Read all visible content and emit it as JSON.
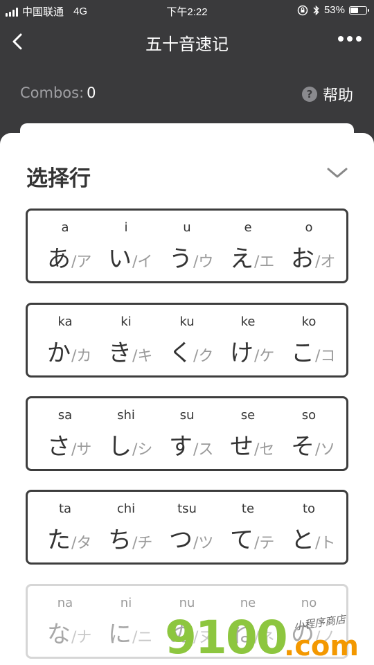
{
  "status": {
    "carrier": "中国联通",
    "network": "4G",
    "time": "下午2:22",
    "battery": "53%",
    "battery_level": 0.53
  },
  "nav": {
    "title": "五十音速记",
    "back_icon": "chevron-left-icon",
    "more_icon": "more-dots-icon"
  },
  "combos": {
    "label": "Combos:",
    "value": "0"
  },
  "help": {
    "label": "帮助",
    "icon": "question-circle-icon"
  },
  "sheet": {
    "title": "选择行",
    "collapse_icon": "chevron-down-icon"
  },
  "rows": [
    {
      "cells": [
        {
          "romaji": "a",
          "hira": "あ",
          "kata": "/ア"
        },
        {
          "romaji": "i",
          "hira": "い",
          "kata": "/イ"
        },
        {
          "romaji": "u",
          "hira": "う",
          "kata": "/ウ"
        },
        {
          "romaji": "e",
          "hira": "え",
          "kata": "/エ"
        },
        {
          "romaji": "o",
          "hira": "お",
          "kata": "/オ"
        }
      ]
    },
    {
      "cells": [
        {
          "romaji": "ka",
          "hira": "か",
          "kata": "/カ"
        },
        {
          "romaji": "ki",
          "hira": "き",
          "kata": "/キ"
        },
        {
          "romaji": "ku",
          "hira": "く",
          "kata": "/ク"
        },
        {
          "romaji": "ke",
          "hira": "け",
          "kata": "/ケ"
        },
        {
          "romaji": "ko",
          "hira": "こ",
          "kata": "/コ"
        }
      ]
    },
    {
      "cells": [
        {
          "romaji": "sa",
          "hira": "さ",
          "kata": "/サ"
        },
        {
          "romaji": "shi",
          "hira": "し",
          "kata": "/シ"
        },
        {
          "romaji": "su",
          "hira": "す",
          "kata": "/ス"
        },
        {
          "romaji": "se",
          "hira": "せ",
          "kata": "/セ"
        },
        {
          "romaji": "so",
          "hira": "そ",
          "kata": "/ソ"
        }
      ]
    },
    {
      "cells": [
        {
          "romaji": "ta",
          "hira": "た",
          "kata": "/タ"
        },
        {
          "romaji": "chi",
          "hira": "ち",
          "kata": "/チ"
        },
        {
          "romaji": "tsu",
          "hira": "つ",
          "kata": "/ツ"
        },
        {
          "romaji": "te",
          "hira": "て",
          "kata": "/テ"
        },
        {
          "romaji": "to",
          "hira": "と",
          "kata": "/ト"
        }
      ]
    },
    {
      "cells": [
        {
          "romaji": "na",
          "hira": "な",
          "kata": "/ナ"
        },
        {
          "romaji": "ni",
          "hira": "に",
          "kata": "/ニ"
        },
        {
          "romaji": "nu",
          "hira": "ぬ",
          "kata": "/ヌ"
        },
        {
          "romaji": "ne",
          "hira": "ね",
          "kata": "/ネ"
        },
        {
          "romaji": "no",
          "hira": "の",
          "kata": "/ノ"
        }
      ]
    }
  ],
  "watermark": {
    "main": "9100",
    "domain": ".com",
    "sub": "小程序商店"
  },
  "colors": {
    "background": "#3a3a3c",
    "card_border": "#3d3d3d",
    "card_border_dim": "#d6d6d6",
    "watermark_green": "#8dc63f",
    "watermark_orange": "#f39800"
  }
}
